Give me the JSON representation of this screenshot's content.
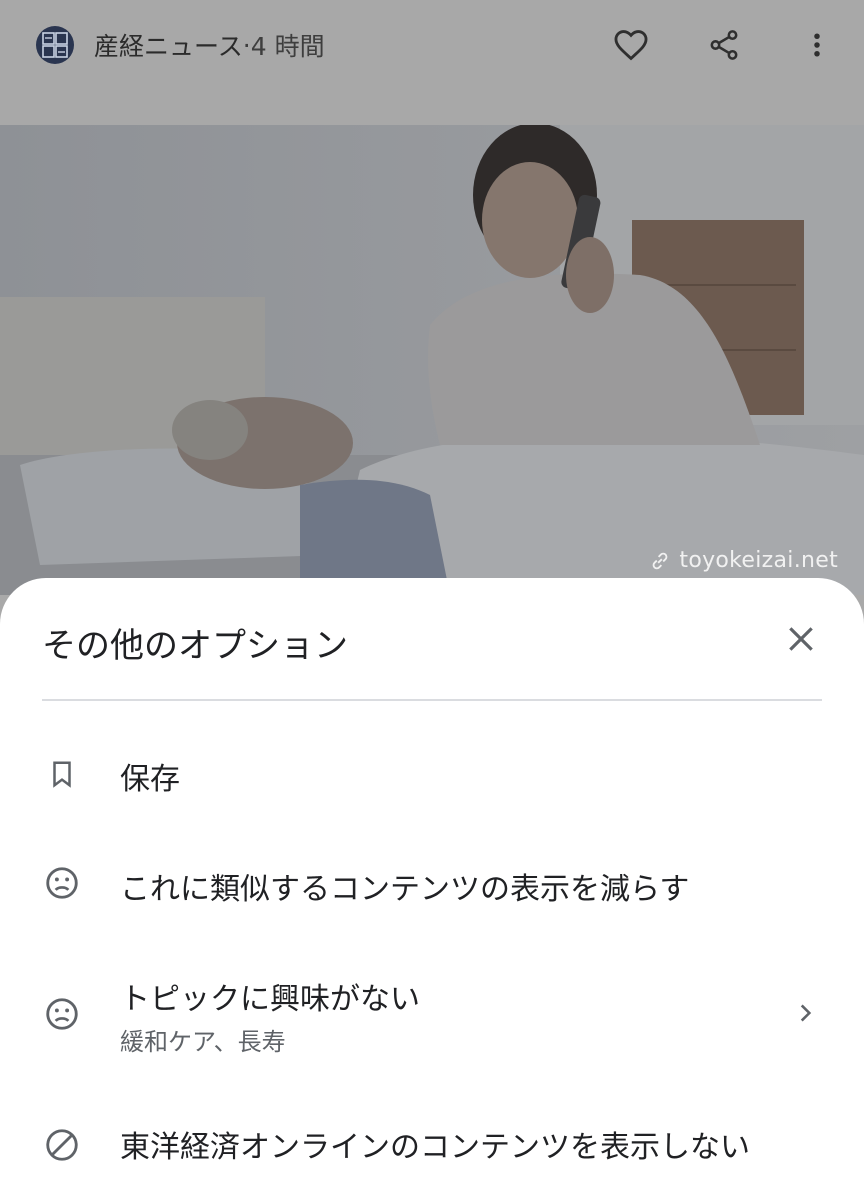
{
  "header": {
    "source_name": "産経ニュース",
    "separator": " · ",
    "time_ago": "4 時間",
    "icons": [
      "favorite-icon",
      "share-icon",
      "more-vert-icon"
    ]
  },
  "photo": {
    "credit": "toyokeizai.net"
  },
  "sheet": {
    "title": "その他のオプション",
    "options": [
      {
        "icon": "bookmark-icon",
        "label": "保存"
      },
      {
        "icon": "sad-face-icon",
        "label": "これに類似するコンテンツの表示を減らす"
      },
      {
        "icon": "sad-face-icon",
        "label": "トピックに興味がない",
        "sublabel": "緩和ケア、長寿"
      },
      {
        "icon": "block-icon",
        "label": "東洋経済オンラインのコンテンツを表示しない"
      }
    ]
  }
}
